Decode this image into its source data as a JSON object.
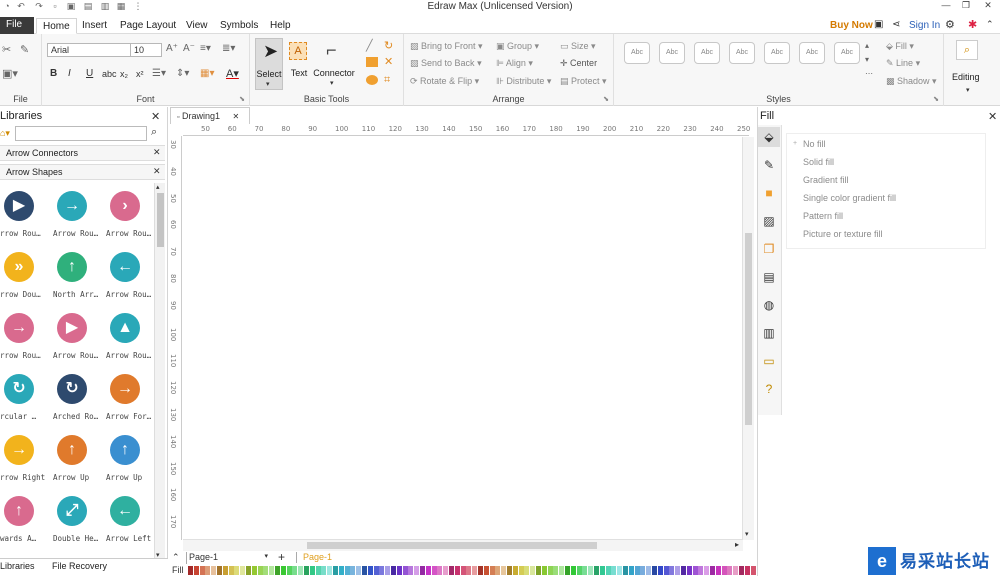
{
  "titlebar": {
    "title": "Edraw Max (Unlicensed Version)",
    "window_icons": [
      "minimize-icon",
      "restore-icon",
      "close-icon"
    ]
  },
  "menu": {
    "file": "File",
    "tabs": [
      "Home",
      "Insert",
      "Page Layout",
      "View",
      "Symbols",
      "Help"
    ],
    "buy_now": "Buy Now",
    "sign_in": "Sign In"
  },
  "ribbon": {
    "font": {
      "family": "Arial",
      "size": "10",
      "label": "Font"
    },
    "file_label": "File",
    "basic_tools": {
      "select": "Select",
      "text": "Text",
      "connector": "Connector",
      "label": "Basic Tools"
    },
    "arrange": {
      "bring_to_front": "Bring to Front",
      "send_to_back": "Send to Back",
      "rotate_flip": "Rotate & Flip",
      "group": "Group",
      "align": "Align",
      "distribute": "Distribute",
      "size": "Size",
      "center": "Center",
      "protect": "Protect",
      "label": "Arrange"
    },
    "styles": {
      "label": "Styles",
      "sample": "Abc"
    },
    "fillline": {
      "fill": "Fill",
      "line": "Line",
      "shadow": "Shadow"
    },
    "editing": "Editing"
  },
  "library": {
    "title": "Libraries",
    "search_placeholder": "",
    "categories": [
      "Arrow Connectors",
      "Arrow Shapes"
    ],
    "shapes": [
      {
        "label": "rrow Rou…",
        "color": "#2e4a6e",
        "glyph": "▶"
      },
      {
        "label": "Arrow Rou…",
        "color": "#2aa8b8",
        "glyph": "→"
      },
      {
        "label": "Arrow Rou…",
        "color": "#d96a8e",
        "glyph": "›"
      },
      {
        "label": "rrow Dou…",
        "color": "#f2b31c",
        "glyph": "»"
      },
      {
        "label": "North Arr…",
        "color": "#2fb07c",
        "glyph": "↑"
      },
      {
        "label": "Arrow Rou…",
        "color": "#2aa8b8",
        "glyph": "←"
      },
      {
        "label": "rrow Rou…",
        "color": "#d96a8e",
        "glyph": "→"
      },
      {
        "label": "Arrow Rou…",
        "color": "#d96a8e",
        "glyph": "▶"
      },
      {
        "label": "Arrow Rou…",
        "color": "#2aa8b8",
        "glyph": "▲"
      },
      {
        "label": "rcular …",
        "color": "#2aa8b8",
        "glyph": "↻"
      },
      {
        "label": "Arched Ro…",
        "color": "#2e4a6e",
        "glyph": "↻"
      },
      {
        "label": "Arrow For…",
        "color": "#e07a2c",
        "glyph": "→"
      },
      {
        "label": "rrow Right",
        "color": "#f2b31c",
        "glyph": "→"
      },
      {
        "label": "Arrow Up",
        "color": "#e07a2c",
        "glyph": "↑"
      },
      {
        "label": "Arrow Up",
        "color": "#3a8fd0",
        "glyph": "↑"
      },
      {
        "label": "wards A…",
        "color": "#d96a8e",
        "glyph": "↑"
      },
      {
        "label": "Double He…",
        "color": "#2aa8b8",
        "glyph": "⤢"
      },
      {
        "label": "Arrow Left",
        "color": "#2fb0a0",
        "glyph": "←"
      }
    ]
  },
  "bottom_tabs": [
    "Libraries",
    "File Recovery"
  ],
  "document": {
    "tab": "Drawing1",
    "page_selector": "Page-1",
    "page_tab": "Page-1"
  },
  "ruler": {
    "h": [
      "50",
      "60",
      "70",
      "80",
      "90",
      "100",
      "110",
      "120",
      "130",
      "140",
      "150",
      "160",
      "170",
      "180",
      "190",
      "200",
      "210",
      "220",
      "230",
      "240",
      "250"
    ],
    "v": [
      "30",
      "40",
      "50",
      "60",
      "70",
      "80",
      "90",
      "100",
      "110",
      "120",
      "130",
      "140",
      "150",
      "160",
      "170"
    ]
  },
  "fill_panel": {
    "title": "Fill",
    "options": [
      "No fill",
      "Solid fill",
      "Gradient fill",
      "Single color gradient fill",
      "Pattern fill",
      "Picture or texture fill"
    ],
    "selected": 0
  },
  "palette_label": "Fill",
  "watermark": "易采站长站"
}
